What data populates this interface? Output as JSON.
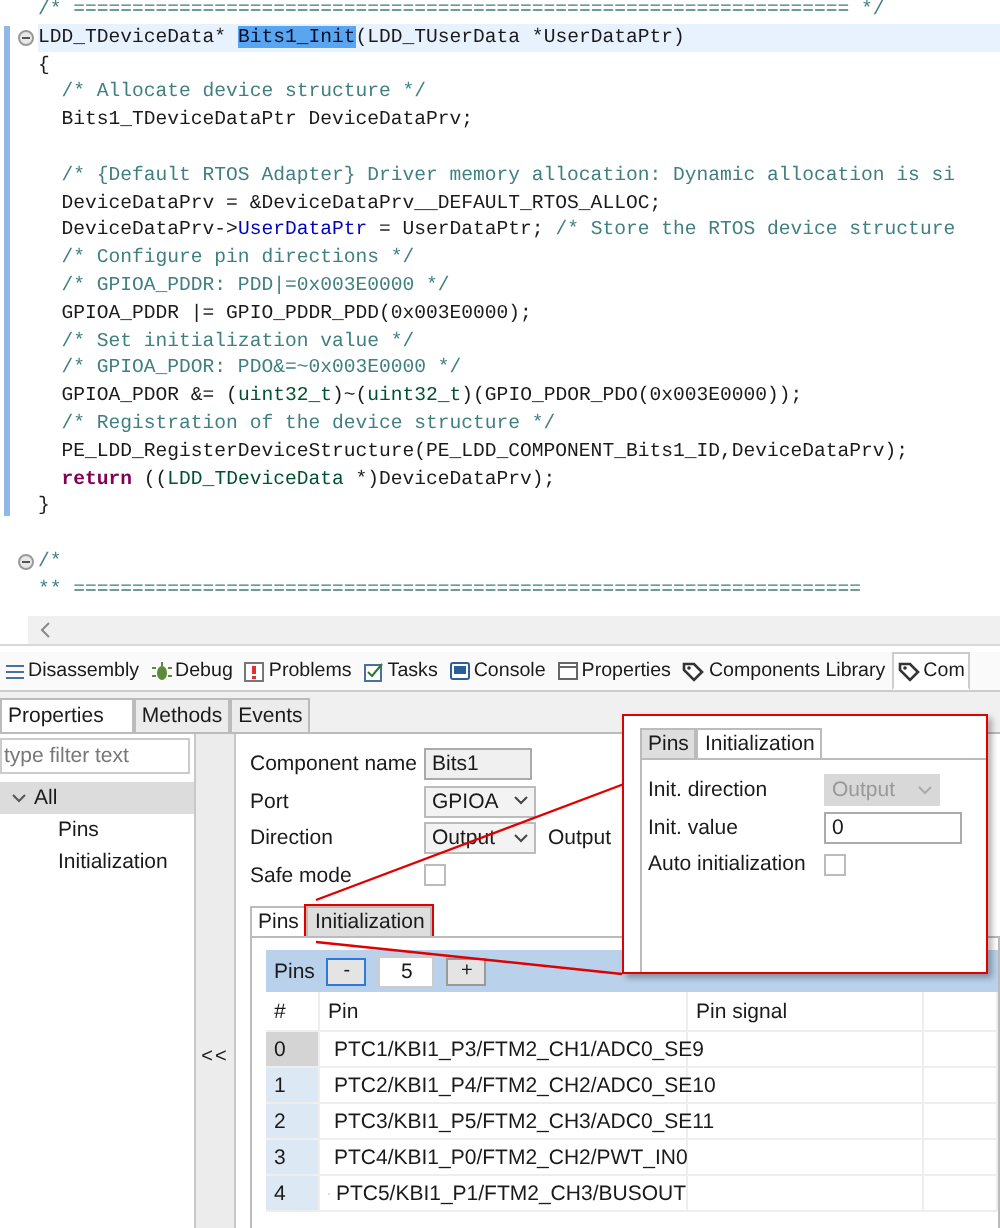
{
  "editor": {
    "lines": [
      {
        "current": false,
        "foldable": false,
        "segments": [
          {
            "text": "/* ================================================================== */",
            "kind": "comment"
          }
        ]
      },
      {
        "current": true,
        "foldable": true,
        "segments": [
          {
            "text": "LDD_TDeviceData* ",
            "kind": "plain"
          },
          {
            "text": "Bits1_Init",
            "kind": "selected"
          },
          {
            "text": "(LDD_TUserData *UserDataPtr)",
            "kind": "plain"
          }
        ]
      },
      {
        "current": false,
        "foldable": false,
        "segments": [
          {
            "text": "{",
            "kind": "plain"
          }
        ],
        "children": [
          {
            "current": false,
            "foldable": false,
            "segments": [
              {
                "text": "/* Allocate device structure */",
                "kind": "comment"
              }
            ]
          },
          {
            "current": false,
            "foldable": false,
            "segments": [
              {
                "text": "Bits1_TDeviceDataPtr DeviceDataPrv;",
                "kind": "plain"
              }
            ]
          },
          {
            "current": false,
            "foldable": false
          },
          {
            "current": false,
            "foldable": false,
            "segments": [
              {
                "text": "/* {Default RTOS Adapter} Driver memory allocation: Dynamic allocation is si",
                "kind": "comment"
              }
            ]
          },
          {
            "current": false,
            "foldable": false,
            "segments": [
              {
                "text": "DeviceDataPrv = &DeviceDataPrv__DEFAULT_RTOS_ALLOC;",
                "kind": "plain"
              }
            ]
          },
          {
            "current": false,
            "foldable": false,
            "segments": [
              {
                "text": "DeviceDataPrv->",
                "kind": "plain"
              },
              {
                "text": "UserDataPtr",
                "kind": "field"
              },
              {
                "text": " = UserDataPtr; ",
                "kind": "plain"
              },
              {
                "text": "/* Store the RTOS device structure",
                "kind": "comment"
              }
            ]
          },
          {
            "current": false,
            "foldable": false,
            "segments": [
              {
                "text": "/* Configure pin directions */",
                "kind": "comment"
              }
            ]
          },
          {
            "current": false,
            "foldable": false,
            "segments": [
              {
                "text": "/* GPIOA_PDDR: PDD|=0x003E0000 */",
                "kind": "comment"
              }
            ]
          },
          {
            "current": false,
            "foldable": false,
            "segments": [
              {
                "text": "GPIOA_PDDR |= GPIO_PDDR_PDD(0x003E0000);",
                "kind": "plain"
              }
            ]
          },
          {
            "current": false,
            "foldable": false,
            "segments": [
              {
                "text": "/* Set initialization value */",
                "kind": "comment"
              }
            ]
          },
          {
            "current": false,
            "foldable": false,
            "segments": [
              {
                "text": "/* GPIOA_PDOR: PDO&=~0x003E0000 */",
                "kind": "comment"
              }
            ]
          },
          {
            "current": false,
            "foldable": false,
            "segments": [
              {
                "text": "GPIOA_PDOR &= (",
                "kind": "plain"
              },
              {
                "text": "uint32_t",
                "kind": "type"
              },
              {
                "text": ")~(",
                "kind": "plain"
              },
              {
                "text": "uint32_t",
                "kind": "type"
              },
              {
                "text": ")(GPIO_PDOR_PDO(0x003E0000));",
                "kind": "plain"
              }
            ]
          },
          {
            "current": false,
            "foldable": false,
            "segments": [
              {
                "text": "/* Registration of the device structure */",
                "kind": "comment"
              }
            ]
          },
          {
            "current": false,
            "foldable": false,
            "segments": [
              {
                "text": "PE_LDD_RegisterDeviceStructure(PE_LDD_COMPONENT_Bits1_ID,DeviceDataPrv);",
                "kind": "plain"
              }
            ]
          },
          {
            "current": false,
            "foldable": false,
            "segments": [
              {
                "text": "return",
                "kind": "keyword"
              },
              {
                "text": " ((",
                "kind": "plain"
              },
              {
                "text": "LDD_TDeviceData",
                "kind": "type"
              },
              {
                "text": " *)DeviceDataPrv);",
                "kind": "plain"
              }
            ]
          }
        ]
      },
      {
        "current": false,
        "foldable": false,
        "segments": [
          {
            "text": "}",
            "kind": "plain"
          }
        ]
      },
      {
        "current": false,
        "foldable": false
      },
      {
        "current": false,
        "foldable": true,
        "segments": [
          {
            "text": "/*",
            "kind": "comment"
          }
        ]
      },
      {
        "current": false,
        "foldable": false,
        "segments": [
          {
            "text": "** ===================================================================",
            "kind": "comment"
          }
        ]
      }
    ]
  },
  "view_tabs": [
    {
      "label": "Disassembly",
      "selected": false
    },
    {
      "label": "Debug",
      "selected": false
    },
    {
      "label": "Problems",
      "selected": false
    },
    {
      "label": "Tasks",
      "selected": false
    },
    {
      "label": "Console",
      "selected": false
    },
    {
      "label": "Properties",
      "selected": false
    },
    {
      "label": "Components Library",
      "selected": false
    },
    {
      "label": "Com",
      "selected": true
    }
  ],
  "sub_tabs": [
    {
      "label": "Properties",
      "selected": true
    },
    {
      "label": "Methods",
      "selected": false
    },
    {
      "label": "Events",
      "selected": false
    }
  ],
  "filter": {
    "placeholder": "type filter text"
  },
  "tree": [
    {
      "label": "All",
      "expanded": true,
      "selected": true,
      "children": [
        {
          "label": "Pins",
          "selected": false
        },
        {
          "label": "Initialization",
          "selected": false
        }
      ]
    }
  ],
  "collapse_button": "<<",
  "fields": [
    {
      "kind": "text",
      "label": "Component name",
      "value": "Bits1",
      "read_only": true
    },
    {
      "kind": "combo",
      "label": "Port",
      "value": "GPIOA",
      "disabled": false
    },
    {
      "kind": "combo",
      "label": "Direction",
      "value": "Output",
      "disabled": false,
      "note": "Output"
    },
    {
      "kind": "checkbox",
      "label": "Safe mode",
      "checked": false
    }
  ],
  "inner_tabs": [
    {
      "label": "Pins",
      "selected": true,
      "marked": false
    },
    {
      "label": "Initialization",
      "selected": false,
      "marked": true
    }
  ],
  "pins_table": {
    "title": "Pins",
    "minus": "-",
    "count": "5",
    "plus": "+",
    "columns": [
      "#",
      "Pin",
      "Pin signal"
    ],
    "rows": [
      {
        "index": "0",
        "pin": "PTC1/KBI1_P3/FTM2_CH1/ADC0_SE9",
        "selected": true
      },
      {
        "index": "1",
        "pin": "PTC2/KBI1_P4/FTM2_CH2/ADC0_SE10",
        "selected": false
      },
      {
        "index": "2",
        "pin": "PTC3/KBI1_P5/FTM2_CH3/ADC0_SE11",
        "selected": false
      },
      {
        "index": "3",
        "pin": "PTC4/KBI1_P0/FTM2_CH2/PWT_IN0",
        "selected": false
      },
      {
        "index": "4",
        "pin": "PTC5/KBI1_P1/FTM2_CH3/BUSOUT",
        "selected": false
      }
    ]
  },
  "callout": {
    "tabs": [
      {
        "label": "Pins",
        "selected": false
      },
      {
        "label": "Initialization",
        "selected": true
      }
    ],
    "fields": [
      {
        "kind": "combo",
        "label": "Init. direction",
        "value": "Output",
        "disabled": true
      },
      {
        "kind": "text",
        "label": "Init. value",
        "value": "0",
        "read_only": false
      },
      {
        "kind": "checkbox",
        "label": "Auto initialization",
        "checked": false
      }
    ]
  }
}
